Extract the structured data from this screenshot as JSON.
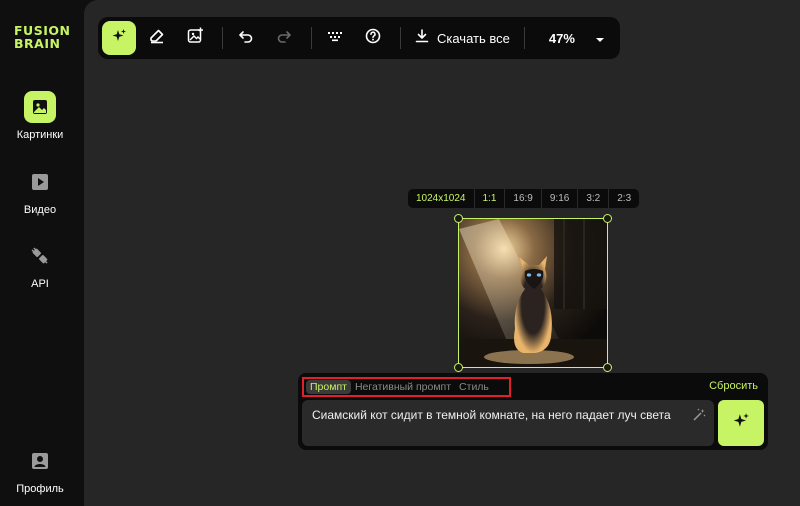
{
  "logo": {
    "line1": "FUSION",
    "line2": "BRAIN"
  },
  "sidebar": {
    "items": [
      {
        "label": "Картинки",
        "icon": "image-icon",
        "active": true
      },
      {
        "label": "Видео",
        "icon": "video-icon",
        "active": false
      },
      {
        "label": "API",
        "icon": "plug-icon",
        "active": false
      },
      {
        "label": "Профиль",
        "icon": "profile-icon",
        "active": false
      }
    ]
  },
  "toolbar": {
    "download_label": "Скачать все",
    "zoom": "47%"
  },
  "ratios": [
    "1024x1024",
    "1:1",
    "16:9",
    "9:16",
    "3:2",
    "2:3"
  ],
  "prompt": {
    "tabs": [
      "Промпт",
      "Негативный промпт",
      "Стиль"
    ],
    "reset_label": "Сбросить",
    "text": "Сиамский кот сидит в темной комнате, на него падает луч света"
  },
  "colors": {
    "accent": "#c7f464",
    "highlight_box": "#e0202a"
  }
}
